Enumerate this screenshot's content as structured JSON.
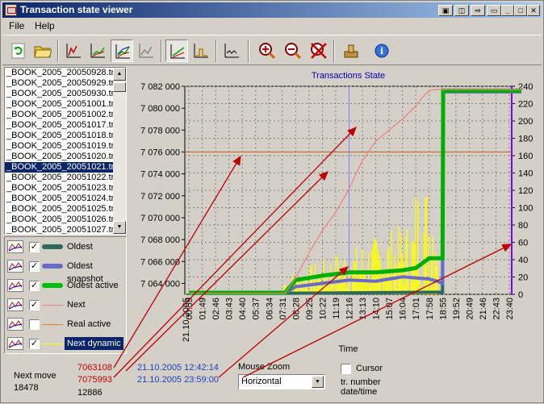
{
  "window": {
    "title": "Transaction state viewer"
  },
  "menu": {
    "file": "File",
    "help": "Help"
  },
  "toolbar": [
    {
      "name": "refresh-icon"
    },
    {
      "name": "open-folder-icon"
    },
    {
      "name": "chart-view-1-icon"
    },
    {
      "name": "chart-view-2-icon"
    },
    {
      "name": "chart-view-3-icon"
    },
    {
      "name": "chart-view-4-icon"
    },
    {
      "name": "line-view-1-icon"
    },
    {
      "name": "line-view-2-icon"
    },
    {
      "name": "line-view-3-icon"
    },
    {
      "name": "zoom-in-icon"
    },
    {
      "name": "zoom-out-icon"
    },
    {
      "name": "zoom-reset-icon"
    },
    {
      "name": "tools-icon"
    },
    {
      "name": "info-icon"
    }
  ],
  "files": [
    "_BOOK_2005_20050928.tn",
    "_BOOK_2005_20050929.tn",
    "_BOOK_2005_20050930.tn",
    "_BOOK_2005_20051001.tn",
    "_BOOK_2005_20051002.tn",
    "_BOOK_2005_20051017.tn",
    "_BOOK_2005_20051018.tn",
    "_BOOK_2005_20051019.tn",
    "_BOOK_2005_20051020.tn",
    "_BOOK_2005_20051021.tn",
    "_BOOK_2005_20051022.tn",
    "_BOOK_2005_20051023.tn",
    "_BOOK_2005_20051024.tn",
    "_BOOK_2005_20051025.tn",
    "_BOOK_2005_20051026.tn",
    "_BOOK_2005_20051027.tn"
  ],
  "selected_file_index": 9,
  "legend": [
    {
      "label": "Oldest",
      "checked": true,
      "color": "#2e6b5a"
    },
    {
      "label": "Oldest snapshot",
      "checked": true,
      "color": "#6a6ac8"
    },
    {
      "label": "Oldest active",
      "checked": true,
      "color": "#00c000"
    },
    {
      "label": "Next",
      "checked": true,
      "color": "#f08080"
    },
    {
      "label": "Real active",
      "checked": false,
      "color": "#e08020"
    },
    {
      "label": "Next dynamic",
      "checked": true,
      "color": "#ffff00"
    }
  ],
  "selected_legend_index": 5,
  "stats": {
    "next_move_label": "Next move",
    "next_move_value": "18478",
    "val1": "7063108",
    "val2": "7075993",
    "val3": "12886",
    "date1": "21.10.2005 12:42:14",
    "date2": "21.10.2005 23:59:00"
  },
  "mouse_zoom": {
    "label": "Mouse Zoom",
    "value": "Horizontal"
  },
  "cursor": {
    "label": "Cursor",
    "checked": false
  },
  "tr_labels": {
    "line1": "tr. number",
    "line2": "date/time"
  },
  "colors": {
    "arrow": "#c00000",
    "axis_right": "#8000ff",
    "title": "#0000c0"
  },
  "chart_data": {
    "type": "line",
    "title": "Transactions State",
    "xlabel": "Time",
    "date_label": "21.10.2005",
    "x_ticks": [
      "00:59",
      "01:49",
      "02:46",
      "03:43",
      "04:40",
      "05:37",
      "06:34",
      "07:31",
      "08:28",
      "09:25",
      "10:22",
      "11:19",
      "12:16",
      "13:13",
      "14:10",
      "15:07",
      "16:04",
      "17:01",
      "17:58",
      "18:55",
      "19:52",
      "20:49",
      "21:46",
      "22:43",
      "23:40"
    ],
    "y_left": {
      "ticks": [
        "7 064 000",
        "7 066 000",
        "7 068 000",
        "7 070 000",
        "7 072 000",
        "7 074 000",
        "7 076 000",
        "7 078 000",
        "7 080 000",
        "7 082 000"
      ],
      "range": [
        7063000,
        7082000
      ]
    },
    "y_right": {
      "ticks": [
        "0",
        "20",
        "40",
        "60",
        "80",
        "100",
        "120",
        "140",
        "160",
        "180",
        "200",
        "220",
        "240"
      ],
      "range": [
        0,
        240
      ]
    },
    "real_active_level": 7076000,
    "series": [
      {
        "name": "Oldest",
        "x": [
          0.0,
          7.2,
          7.8,
          19.0,
          19.05,
          24.9
        ],
        "y": [
          7063100,
          7063100,
          7063100,
          7063200,
          7081500,
          7081500
        ]
      },
      {
        "name": "Oldest snapshot",
        "x": [
          0.0,
          7.2,
          8.0,
          10.0,
          12.0,
          14.0,
          16.0,
          18.0,
          18.6,
          19.0,
          19.05,
          24.9
        ],
        "y": [
          7063100,
          7063100,
          7063700,
          7064000,
          7064300,
          7064200,
          7064600,
          7064400,
          7064200,
          7064000,
          7081500,
          7081500
        ]
      },
      {
        "name": "Oldest active",
        "x": [
          0.0,
          7.2,
          8.0,
          10.0,
          12.0,
          14.0,
          16.0,
          17.0,
          18.0,
          18.6,
          19.0,
          19.05,
          24.9
        ],
        "y": [
          7063150,
          7063150,
          7064300,
          7064700,
          7065000,
          7065000,
          7065200,
          7065400,
          7066300,
          7066300,
          7066300,
          7081600,
          7081600
        ]
      },
      {
        "name": "Next",
        "x": [
          0.0,
          7.2,
          8.0,
          9.0,
          10.0,
          11.0,
          12.0,
          12.5,
          13.0,
          14.0,
          15.0,
          16.0,
          17.0,
          17.5,
          18.0,
          18.4,
          24.9
        ],
        "y": [
          7063100,
          7063100,
          7064500,
          7066800,
          7068800,
          7070500,
          7072600,
          7074000,
          7075200,
          7077000,
          7078000,
          7079000,
          7080200,
          7081000,
          7081600,
          7081700,
          7081700
        ]
      },
      {
        "name": "Next dynamic",
        "x": [],
        "y": []
      }
    ],
    "cursor_x_tick": "12:16"
  }
}
